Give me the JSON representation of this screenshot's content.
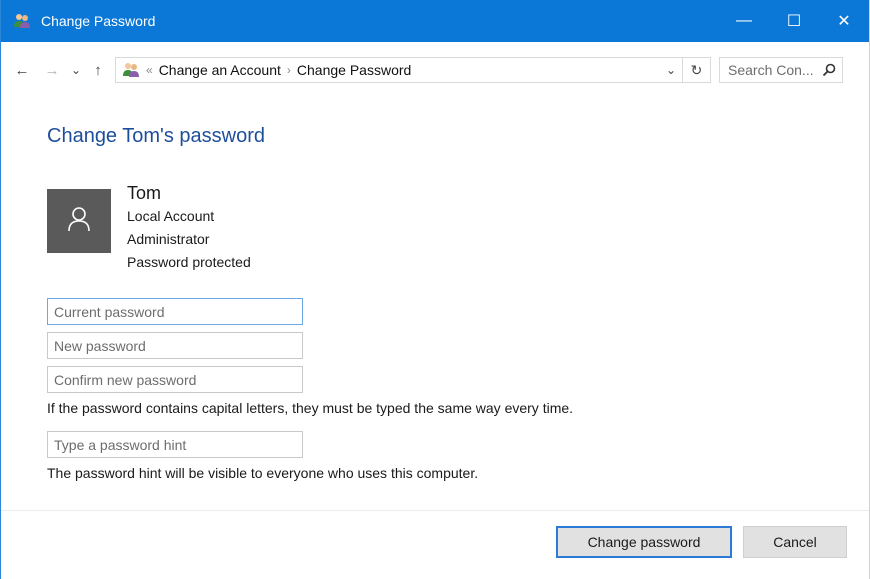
{
  "window": {
    "title": "Change Password",
    "controls": {
      "minimize": "—",
      "maximize": "☐",
      "close": "✕"
    }
  },
  "address_bar": {
    "back": "←",
    "forward": "→",
    "recent": "⌄",
    "up": "↑",
    "separator": "«",
    "breadcrumbs": [
      "Change an Account",
      "Change Password"
    ],
    "crumb_separator": "›",
    "dropdown": "⌄",
    "refresh": "↻",
    "search_placeholder": "Search Con..."
  },
  "page": {
    "heading": "Change Tom's password",
    "user": {
      "name": "Tom",
      "lines": [
        "Local Account",
        "Administrator",
        "Password protected"
      ]
    },
    "fields": {
      "current_password_placeholder": "Current password",
      "new_password_placeholder": "New password",
      "confirm_password_placeholder": "Confirm new password",
      "hint_placeholder": "Type a password hint"
    },
    "case_note": "If the password contains capital letters, they must be typed the same way every time.",
    "hint_note": "The password hint will be visible to everyone who uses this computer."
  },
  "buttons": {
    "change_password": "Change password",
    "cancel": "Cancel"
  },
  "colors": {
    "titlebar": "#0b78d7",
    "heading": "#1e4e9b",
    "primary_border": "#2c7ad6",
    "avatar_bg": "#5a5a5a"
  },
  "icons": [
    "users-icon",
    "back-arrow-icon",
    "forward-arrow-icon",
    "chevron-down-icon",
    "up-arrow-icon",
    "control-panel-icon",
    "refresh-icon",
    "search-icon",
    "user-avatar-icon"
  ]
}
